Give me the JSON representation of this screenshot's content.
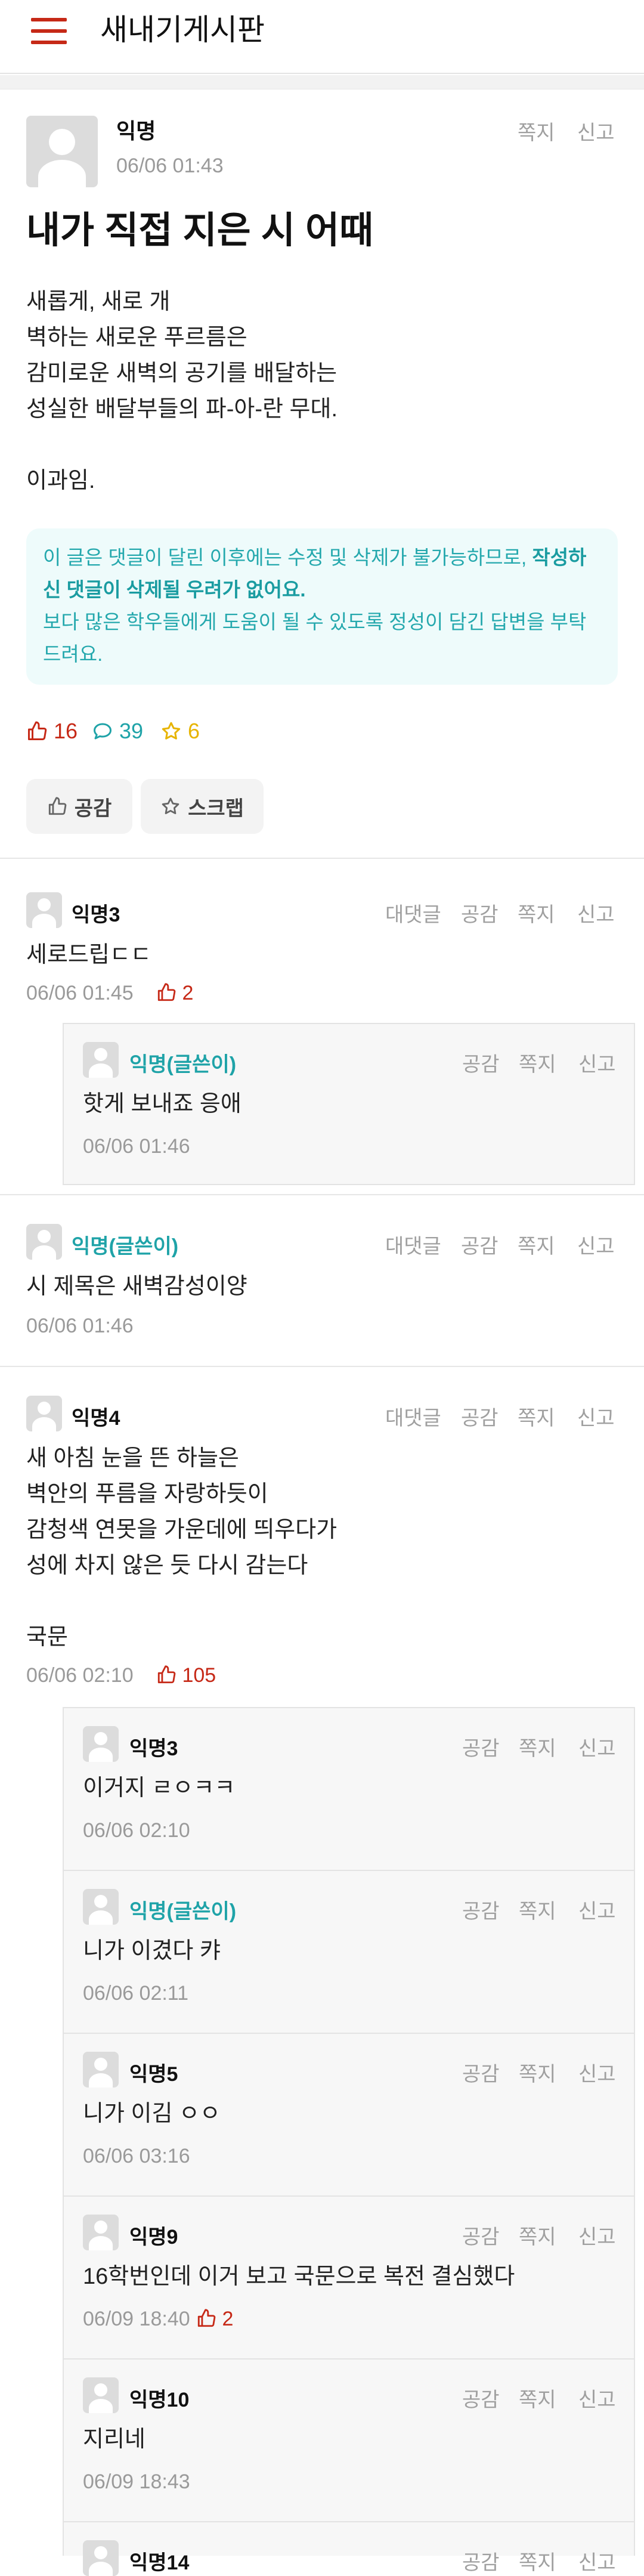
{
  "header": {
    "title": "새내기게시판"
  },
  "article": {
    "author": "익명",
    "time": "06/06 01:43",
    "message_label": "쪽지",
    "report_label": "신고",
    "title": "내가 직접 지은 시 어때",
    "body": "새롭게, 새로 개\n벽하는 새로운 푸르름은\n감미로운 새벽의 공기를 배달하는\n성실한 배달부들의 파-아-란 무대.\n\n이과임.",
    "notice_plain_1": "이 글은 댓글이 달린 이후에는 수정 및 삭제가 불가능하므로, ",
    "notice_bold": "작성하신 댓글이 삭제될 우려가 없어요.",
    "notice_plain_2": "보다 많은 학우들에게 도움이 될 수 있도록 정성이 담긴 답변을 부탁드려요.",
    "likes": "16",
    "comments": "39",
    "scraps": "6",
    "like_button": "공감",
    "scrap_button": "스크랩"
  },
  "labels": {
    "reply": "대댓글",
    "like": "공감",
    "message": "쪽지",
    "report": "신고"
  },
  "comments": [
    {
      "author": "익명3",
      "writer": false,
      "text": "세로드립ㄷㄷ",
      "time": "06/06 01:45",
      "likes": "2",
      "replies": [
        {
          "author": "익명(글쓴이)",
          "writer": true,
          "text": "핫게 보내죠 응애",
          "time": "06/06 01:46",
          "likes": ""
        }
      ]
    },
    {
      "author": "익명(글쓴이)",
      "writer": true,
      "text": "시 제목은 새벽감성이양",
      "time": "06/06 01:46",
      "likes": "",
      "replies": []
    },
    {
      "author": "익명4",
      "writer": false,
      "text": "새 아침 눈을 뜬 하늘은\n벽안의 푸름을 자랑하듯이\n감청색 연못을 가운데에 띄우다가\n성에 차지 않은 듯 다시 감는다\n\n국문",
      "time": "06/06 02:10",
      "likes": "105",
      "replies": [
        {
          "author": "익명3",
          "writer": false,
          "text": "이거지 ㄹㅇㅋㅋ",
          "time": "06/06 02:10",
          "likes": ""
        },
        {
          "author": "익명(글쓴이)",
          "writer": true,
          "text": "니가 이겼다 캬",
          "time": "06/06 02:11",
          "likes": ""
        },
        {
          "author": "익명5",
          "writer": false,
          "text": "니가 이김 ㅇㅇ",
          "time": "06/06 03:16",
          "likes": ""
        },
        {
          "author": "익명9",
          "writer": false,
          "text": "16학번인데 이거 보고 국문으로 복전 결심했다",
          "time": "06/09 18:40",
          "likes": "2"
        },
        {
          "author": "익명10",
          "writer": false,
          "text": "지리네",
          "time": "06/09 18:43",
          "likes": ""
        },
        {
          "author": "익명14",
          "writer": false,
          "text": "",
          "time": "",
          "likes": ""
        }
      ]
    }
  ],
  "colors": {
    "accent": "#c62917",
    "writer": "#1fa3a8",
    "notice_bg": "#eefbfb",
    "scrap": "#e7b400"
  },
  "icons": {
    "menu": "hamburger-icon",
    "like": "thumbs-up-icon",
    "comment": "speech-bubble-icon",
    "scrap": "star-icon",
    "avatar": "default-avatar-icon"
  }
}
